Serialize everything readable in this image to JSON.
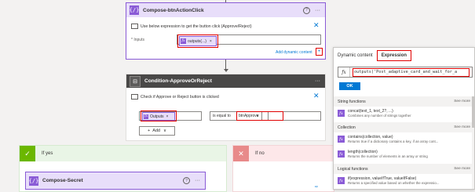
{
  "compose_action": {
    "title": "Compose-btnActionClick",
    "help_glyph": "?",
    "more_glyph": "···",
    "note": "Use below expression to get the button click (Approve/Reject)",
    "inputs_label": "* Inputs",
    "token_label": "outputs(...)",
    "token_remove": "×",
    "add_dynamic_link": "Add dynamic content",
    "close_glyph": "✕"
  },
  "condition_action": {
    "title": "Condition-ApproveOrReject",
    "more_glyph": "···",
    "note": "Check if Approve or Reject button is clicked",
    "left_token": "Outputs",
    "operator": "is equal to",
    "right_value": "btnApprove",
    "add_button": "Add",
    "close_glyph": "✕"
  },
  "branches": {
    "yes_label": "If yes",
    "no_label": "If no",
    "yes_action_title": "Compose-Secret",
    "yes_action_more": "···"
  },
  "panel": {
    "tab_dynamic": "Dynamic content",
    "tab_expression": "Expression",
    "expression_text": "outputs('Post_adaptive_card_and_wait_for_a",
    "ok_label": "OK",
    "sections": [
      {
        "title": "String functions",
        "see_more": "See more",
        "items": [
          {
            "name": "concat(text_1, text_2?, ...)",
            "desc": "Combines any number of strings together"
          }
        ]
      },
      {
        "title": "Collection",
        "see_more": "See more",
        "items": [
          {
            "name": "contains(collection, value)",
            "desc": "Returns true if a dictionary contains a key, if an array cont..."
          },
          {
            "name": "length(collection)",
            "desc": "Returns the number of elements in an array or string"
          }
        ]
      },
      {
        "title": "Logical functions",
        "see_more": "See more",
        "items": [
          {
            "name": "if(expression, valueIfTrue, valueIfFalse)",
            "desc": "Returns a specified value based on whether the expressio..."
          }
        ]
      }
    ]
  },
  "icons": {
    "compose": "compose-braces-icon",
    "condition": "condition-icon",
    "function": "fx-icon",
    "check": "checkmark-icon",
    "close": "close-icon"
  },
  "colors": {
    "compose_accent": "#8a5bd6",
    "condition_header": "#494847",
    "yes_green": "#6bb700",
    "no_red": "#e88a8a",
    "highlight_red": "#e00000",
    "link_blue": "#0078d4"
  },
  "misc": {
    "fx_glyph": "fx",
    "compose_glyph": "{/}",
    "check_glyph": "✓",
    "x_glyph": "✕",
    "add_glyph": "+",
    "token_remove": "×",
    "dropdown_glyph": "∨",
    "cropped_link": "ᵉᵖ"
  }
}
